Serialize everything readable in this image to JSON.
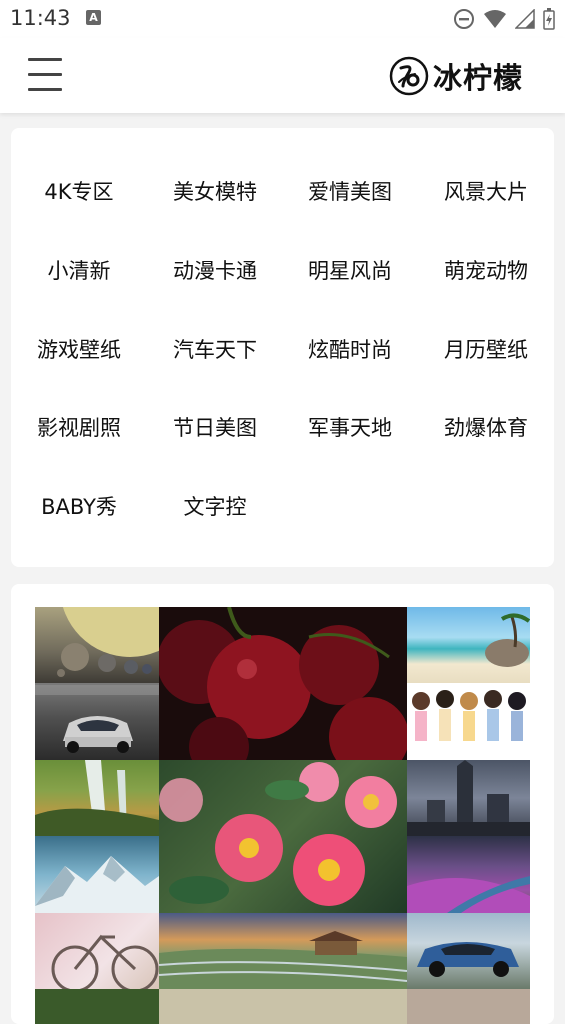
{
  "status_bar": {
    "time": "11:43",
    "notification_icon": "a-badge-icon",
    "icons": [
      "dnd-icon",
      "wifi-icon",
      "signal-icon",
      "battery-icon"
    ]
  },
  "header": {
    "menu_icon": "menu-icon",
    "logo_icon": "bingningmeng-logo-icon",
    "app_name": "冰柠檬"
  },
  "categories": [
    "4K专区",
    "美女模特",
    "爱情美图",
    "风景大片",
    "小清新",
    "动漫卡通",
    "明星风尚",
    "萌宠动物",
    "游戏壁纸",
    "汽车天下",
    "炫酷时尚",
    "月历壁纸",
    "影视剧照",
    "节日美图",
    "军事天地",
    "劲爆体育",
    "BABY秀",
    "文字控"
  ],
  "gallery": {
    "tiles": [
      "planets-image",
      "cherries-image",
      "beach-image",
      "sports-car-image",
      "anime-girls-image",
      "waterfall-image",
      "camellia-flowers-image",
      "city-tower-image",
      "snow-mountain-image",
      "flower-field-image",
      "bicycle-image",
      "rice-terraces-image",
      "blue-car-image"
    ]
  }
}
